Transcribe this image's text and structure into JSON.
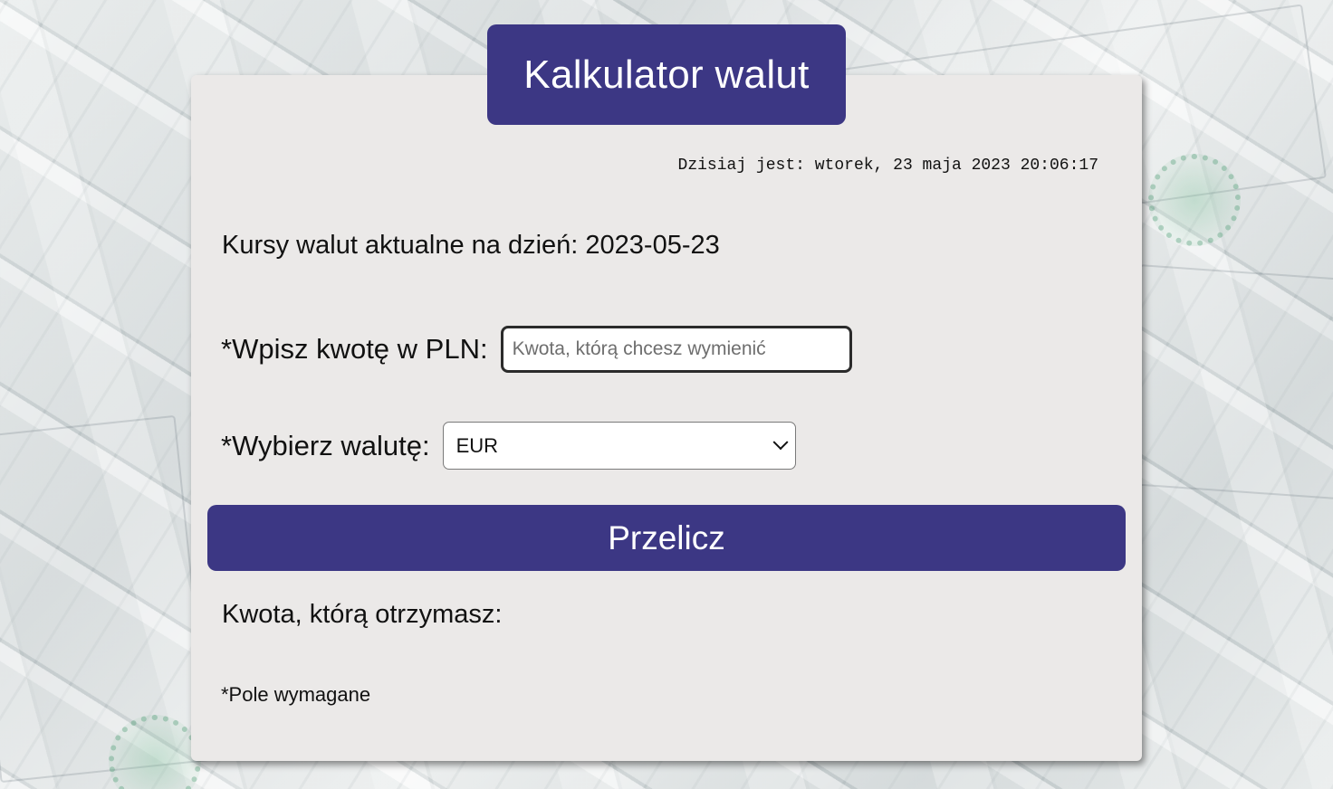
{
  "app": {
    "title": "Kalkulator walut"
  },
  "clock": {
    "text": "Dzisiaj jest: wtorek, 23 maja 2023 20:06:17"
  },
  "rates": {
    "heading": "Kursy walut aktualne na dzień: 2023-05-23"
  },
  "form": {
    "amount_label": "*Wpisz kwotę w PLN:",
    "amount_placeholder": "Kwota, którą chcesz wymienić",
    "amount_value": "",
    "currency_label": "*Wybierz walutę:",
    "currency_selected": "EUR",
    "submit_label": "Przelicz"
  },
  "result": {
    "label": "Kwota, którą otrzymasz:",
    "value": ""
  },
  "footer": {
    "required_note": "*Pole wymagane"
  },
  "colors": {
    "accent": "#3c3784",
    "card_background": "#ebe9e8",
    "text": "#111111"
  },
  "icons": {
    "select_chevron": "chevron-down-icon"
  }
}
